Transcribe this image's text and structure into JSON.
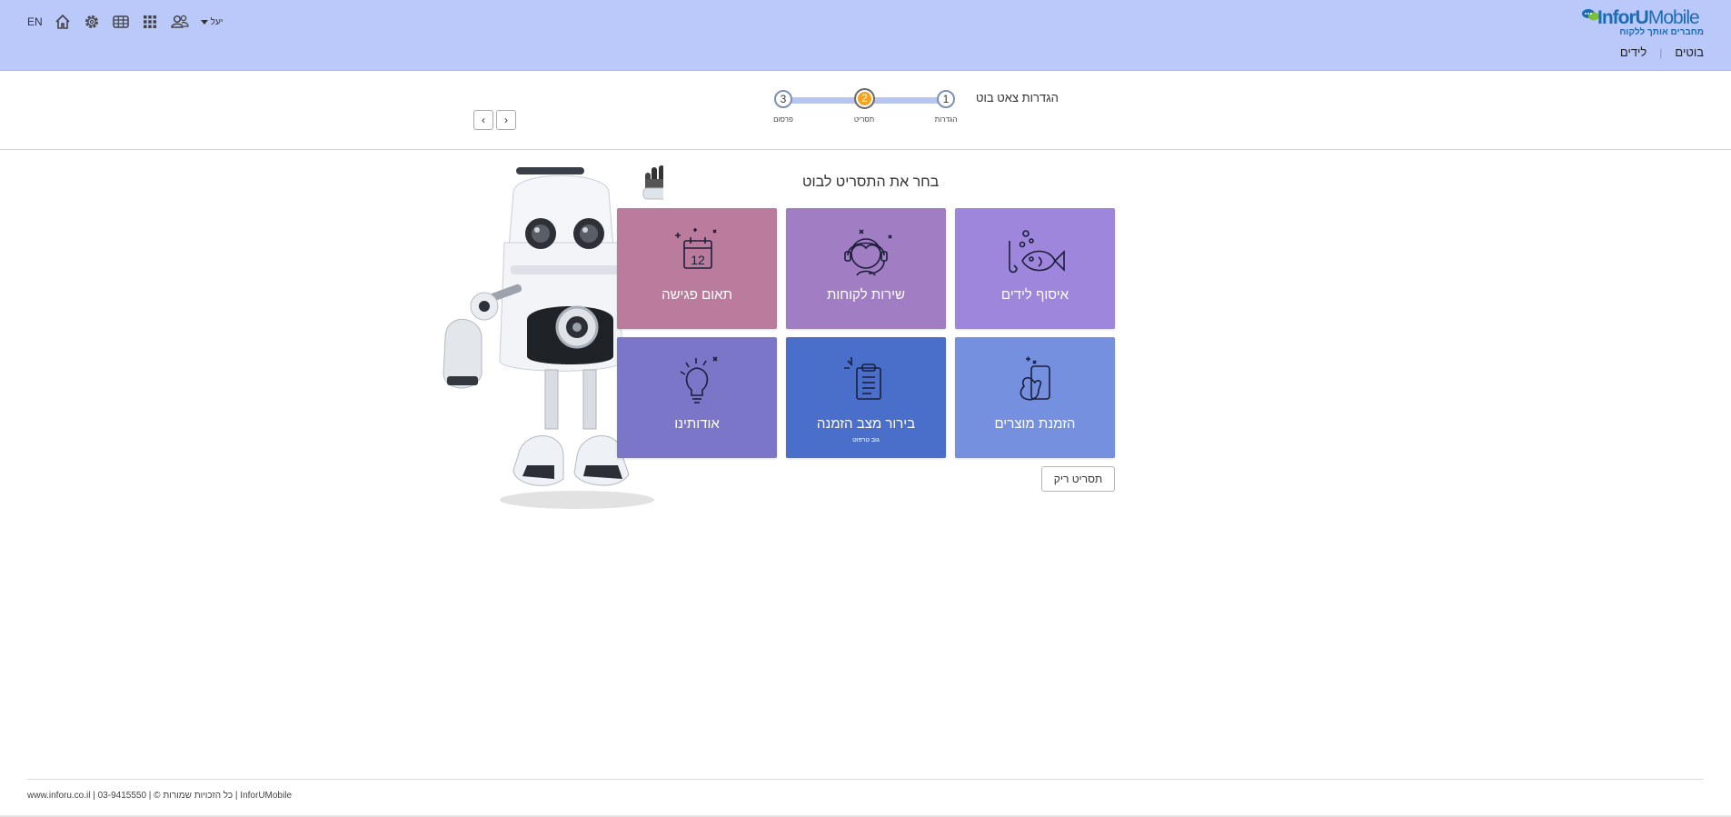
{
  "header": {
    "logo_main": "InforU",
    "logo_mobile": "Mobile",
    "logo_tagline": "מחברים אותך ללקוח",
    "nav": [
      "בוטים",
      "לידים"
    ],
    "user_name": "יעל",
    "lang": "EN",
    "icons": [
      "contacts-icon",
      "apps-grid-icon",
      "table-icon",
      "gear-icon",
      "home-icon"
    ]
  },
  "wizard": {
    "title": "הגדרות צאט בוט",
    "steps": [
      {
        "num": "1",
        "label": "הגדרות",
        "state": "done"
      },
      {
        "num": "2",
        "label": "תסריט",
        "state": "active"
      },
      {
        "num": "3",
        "label": "פרסום",
        "state": "pending"
      }
    ],
    "prev_glyph": "‹",
    "next_glyph": "›"
  },
  "main": {
    "title": "בחר את התסריט לבוט",
    "tiles": [
      {
        "label": "איסוף לידים",
        "sub": "",
        "color": "#9d86dc",
        "icon": "fish-hook-icon"
      },
      {
        "label": "שירות לקוחות",
        "sub": "",
        "color": "#a17dc4",
        "icon": "headset-agent-icon"
      },
      {
        "label": "תאום פגישה",
        "sub": "",
        "color": "#bb7b9d",
        "icon": "calendar-icon"
      },
      {
        "label": "הזמנת מוצרים",
        "sub": "",
        "color": "#7590df",
        "icon": "phone-hand-icon"
      },
      {
        "label": "בירור מצב הזמנה",
        "sub": "גוב טרפוט",
        "color": "#4a6fcb",
        "icon": "clipboard-icon"
      },
      {
        "label": "אודותינו",
        "sub": "",
        "color": "#7b76c7",
        "icon": "lightbulb-icon"
      }
    ],
    "calendar_day": "12",
    "empty_script": "תסריט ריק"
  },
  "footer": {
    "text": "www.inforu.co.il | 03-9415550 | © כל הזכויות שמורות | InforUMobile"
  },
  "colors": {
    "header_bg": "#bac8fa",
    "step_active": "#f7a121",
    "track": "#b6c6f2"
  }
}
